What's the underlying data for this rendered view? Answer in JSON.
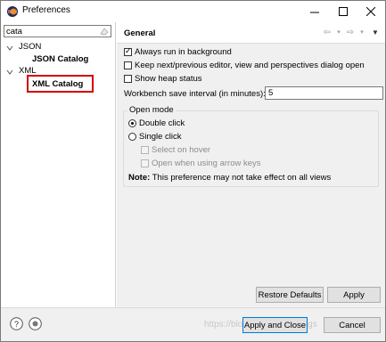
{
  "window": {
    "title": "Preferences",
    "controls": {
      "minimize": "minimize",
      "maximize": "maximize",
      "close": "close"
    }
  },
  "left": {
    "filter": {
      "value": "cata"
    },
    "tree": [
      {
        "label": "JSON",
        "expanded": true,
        "children": [
          {
            "label": "JSON Catalog"
          }
        ]
      },
      {
        "label": "XML",
        "expanded": true,
        "children": [
          {
            "label": "XML Catalog",
            "highlighted": true
          }
        ]
      }
    ]
  },
  "page": {
    "title": "General",
    "options": {
      "always_run_background": {
        "label": "Always run in background",
        "checked": true
      },
      "keep_next_prev": {
        "label": "Keep next/previous editor, view and perspectives dialog open",
        "checked": false
      },
      "show_heap": {
        "label": "Show heap status",
        "checked": false
      }
    },
    "save_interval": {
      "label": "Workbench save interval (in minutes):",
      "value": "5"
    },
    "open_mode": {
      "title": "Open mode",
      "double_click": {
        "label": "Double click",
        "selected": true
      },
      "single_click": {
        "label": "Single click",
        "selected": false
      },
      "select_on_hover": {
        "label": "Select on hover",
        "enabled": false
      },
      "open_arrow_keys": {
        "label": "Open when using arrow keys",
        "enabled": false
      }
    },
    "note": {
      "bold": "Note:",
      "text": "This preference may not take effect on all views"
    },
    "buttons": {
      "restore_defaults": "Restore Defaults",
      "apply": "Apply"
    }
  },
  "bottom": {
    "buttons": {
      "apply_close": "Apply and Close",
      "cancel": "Cancel"
    },
    "watermark": "https://blog.csdn.net/cnblogs"
  },
  "colors": {
    "highlight_border": "#d20000",
    "default_button_border": "#0078d7",
    "dialog_bg": "#f0f0f0"
  }
}
